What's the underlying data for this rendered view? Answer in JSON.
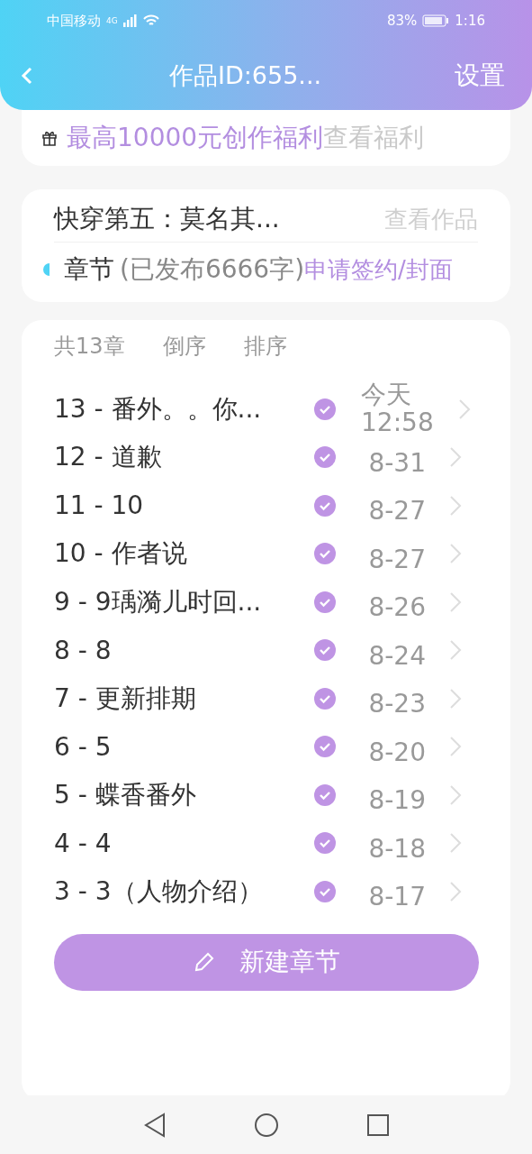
{
  "status_bar": {
    "carrier": "中国移动",
    "network": "4G",
    "battery": "83%",
    "time": "1:16"
  },
  "header": {
    "title": "作品ID:655...",
    "action": "设置"
  },
  "promo": {
    "text": "最高10000元创作福利",
    "link": "查看福利"
  },
  "work": {
    "title": "快穿第五：莫名其...",
    "view": "查看作品",
    "section": "章节",
    "published": "(已发布6666字)",
    "sign": "申请签约/封面"
  },
  "chapter_list": {
    "count": "共13章",
    "tabs": [
      {
        "label": "倒序"
      },
      {
        "label": "排序"
      }
    ],
    "chapters": [
      {
        "title": "13 - 番外。。你...",
        "published": true,
        "date": "今天 12:58"
      },
      {
        "title": "12 - 道歉",
        "published": true,
        "date": "8-31"
      },
      {
        "title": "11 - 10",
        "published": true,
        "date": "8-27"
      },
      {
        "title": "10 - 作者说",
        "published": true,
        "date": "8-27"
      },
      {
        "title": "9 - 9瑀漪儿时回...",
        "published": true,
        "date": "8-26"
      },
      {
        "title": "8 - 8",
        "published": true,
        "date": "8-24"
      },
      {
        "title": "7 - 更新排期",
        "published": true,
        "date": "8-23"
      },
      {
        "title": "6 - 5",
        "published": true,
        "date": "8-20"
      },
      {
        "title": "5 - 蝶香番外",
        "published": true,
        "date": "8-19"
      },
      {
        "title": "4 - 4",
        "published": true,
        "date": "8-18"
      },
      {
        "title": "3 - 3（人物介绍）",
        "published": true,
        "date": "8-17"
      }
    ],
    "new_button": "新建章节"
  }
}
